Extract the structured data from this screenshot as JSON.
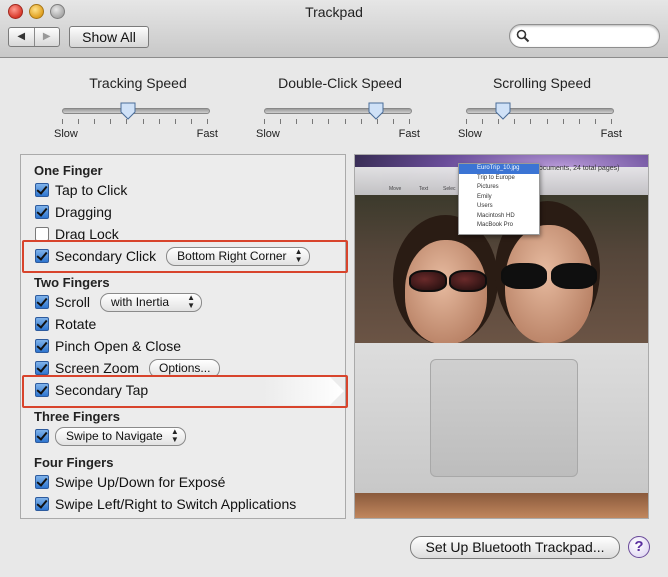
{
  "window": {
    "title": "Trackpad"
  },
  "toolbar": {
    "back_icon": "◀",
    "forward_icon": "▶",
    "show_all_label": "Show All",
    "search_value": "",
    "search_placeholder": ""
  },
  "sliders": [
    {
      "title": "Tracking Speed",
      "min_label": "Slow",
      "max_label": "Fast",
      "value_fraction": 0.45
    },
    {
      "title": "Double-Click Speed",
      "min_label": "Slow",
      "max_label": "Fast",
      "value_fraction": 0.77
    },
    {
      "title": "Scrolling Speed",
      "min_label": "Slow",
      "max_label": "Fast",
      "value_fraction": 0.25
    }
  ],
  "options": {
    "one_finger": {
      "heading": "One Finger",
      "tap_to_click": {
        "label": "Tap to Click",
        "checked": true
      },
      "dragging": {
        "label": "Dragging",
        "checked": true
      },
      "drag_lock": {
        "label": "Drag Lock",
        "checked": false
      },
      "secondary_click": {
        "label": "Secondary Click",
        "checked": true,
        "popup": "Bottom Right Corner"
      }
    },
    "two_fingers": {
      "heading": "Two Fingers",
      "scroll": {
        "label": "Scroll",
        "checked": true,
        "popup": "with Inertia"
      },
      "rotate": {
        "label": "Rotate",
        "checked": true
      },
      "pinch": {
        "label": "Pinch Open & Close",
        "checked": true
      },
      "screen_zoom": {
        "label": "Screen Zoom",
        "checked": true,
        "button": "Options..."
      },
      "secondary_tap": {
        "label": "Secondary Tap",
        "checked": true
      }
    },
    "three_fingers": {
      "heading": "Three Fingers",
      "swipe": {
        "checked": true,
        "popup": "Swipe to Navigate"
      }
    },
    "four_fingers": {
      "heading": "Four Fingers",
      "swipe_updown": {
        "label": "Swipe Up/Down for Exposé",
        "checked": true
      },
      "swipe_leftright": {
        "label": "Swipe Left/Right to Switch Applications",
        "checked": true
      }
    }
  },
  "video": {
    "finder_info": "documents, 24 total pages)",
    "menu_items": [
      "EuroTrip_10.jpg",
      "Trip to Europe",
      "Pictures",
      "Emily",
      "Users",
      "Macintosh HD",
      "MacBook Pro"
    ],
    "toolbar_labels": [
      "Move",
      "Text",
      "Selec"
    ]
  },
  "footer": {
    "bluetooth_button": "Set Up Bluetooth Trackpad...",
    "help_label": "?"
  },
  "colors": {
    "highlight": "#d8442c",
    "checkbox": "#2f76d0",
    "help": "#5a2fa0"
  }
}
